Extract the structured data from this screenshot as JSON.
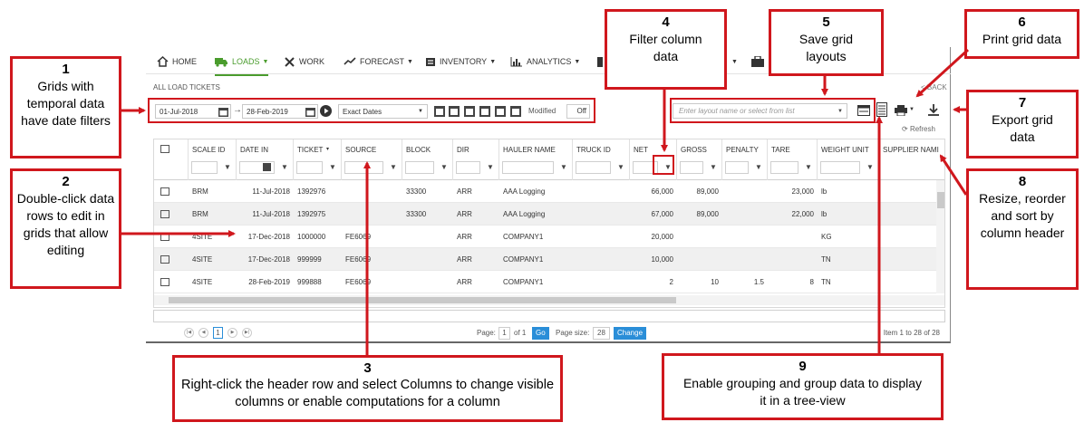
{
  "nav": {
    "items": [
      {
        "label": "HOME",
        "icon": "home-icon",
        "caret": ""
      },
      {
        "label": "LOADS",
        "icon": "truck-icon",
        "caret": "▼"
      },
      {
        "label": "WORK",
        "icon": "tools-icon",
        "caret": ""
      },
      {
        "label": "FORECAST",
        "icon": "trend-icon",
        "caret": "▼"
      },
      {
        "label": "INVENTORY",
        "icon": "inventory-icon",
        "caret": "▼"
      },
      {
        "label": "ANALYTICS",
        "icon": "bar-chart-icon",
        "caret": "▼"
      }
    ],
    "active": "LOADS",
    "accent": "#4a9c2d"
  },
  "breadcrumb": "ALL LOAD TICKETS",
  "back": "< BACK",
  "filters": {
    "start_date": "01-Jul-2018",
    "end_date": "28-Feb-2019",
    "arrow": "→",
    "mode": "Exact Dates",
    "modified_label": "Modified",
    "toggle": "Off"
  },
  "layout_placeholder": "Enter layout name or select from list",
  "refresh": "Refresh",
  "grid": {
    "columns": [
      "SCALE ID",
      "DATE IN",
      "TICKET",
      "SOURCE",
      "BLOCK",
      "DIR",
      "HAULER NAME",
      "TRUCK ID",
      "NET",
      "GROSS",
      "PENALTY",
      "TARE",
      "WEIGHT UNIT",
      "SUPPLIER NAMI"
    ],
    "rows": [
      [
        "BRM",
        "11-Jul-2018",
        "1392976",
        "",
        "33300",
        "ARR",
        "AAA Logging",
        "",
        "66,000",
        "89,000",
        "",
        "23,000",
        "lb",
        ""
      ],
      [
        "BRM",
        "11-Jul-2018",
        "1392975",
        "",
        "33300",
        "ARR",
        "AAA Logging",
        "",
        "67,000",
        "89,000",
        "",
        "22,000",
        "lb",
        ""
      ],
      [
        "4SITE",
        "17-Dec-2018",
        "1000000",
        "FE6069",
        "",
        "ARR",
        "COMPANY1",
        "",
        "20,000",
        "",
        "",
        "",
        "KG",
        ""
      ],
      [
        "4SITE",
        "17-Dec-2018",
        "999999",
        "FE6069",
        "",
        "ARR",
        "COMPANY1",
        "",
        "10,000",
        "",
        "",
        "",
        "TN",
        ""
      ],
      [
        "4SITE",
        "28-Feb-2019",
        "999888",
        "FE6069",
        "",
        "ARR",
        "COMPANY1",
        "",
        "2",
        "10",
        "1.5",
        "8",
        "TN",
        ""
      ]
    ]
  },
  "pager": {
    "page_label": "Page:",
    "page": "1",
    "of": "of 1",
    "go": "Go",
    "size_label": "Page size:",
    "size": "28",
    "change": "Change",
    "current": "1",
    "items": "Item 1 to 28 of 28"
  },
  "callouts": [
    {
      "num": "1",
      "text": "Grids with temporal data have date filters"
    },
    {
      "num": "2",
      "text": "Double-click data rows to edit in grids that allow editing"
    },
    {
      "num": "3",
      "text": "Right-click the header row and select Columns to change visible columns or enable computations for a column"
    },
    {
      "num": "4",
      "text": "Filter column data"
    },
    {
      "num": "5",
      "text": "Save grid layouts"
    },
    {
      "num": "6",
      "text": "Print grid data"
    },
    {
      "num": "7",
      "text": "Export grid data"
    },
    {
      "num": "8",
      "text": "Resize, reorder and sort by column header"
    },
    {
      "num": "9",
      "text": "Enable grouping and group data to display it in a tree-view"
    }
  ],
  "colors": {
    "callout": "#d0171d",
    "button": "#2a8ed8"
  }
}
